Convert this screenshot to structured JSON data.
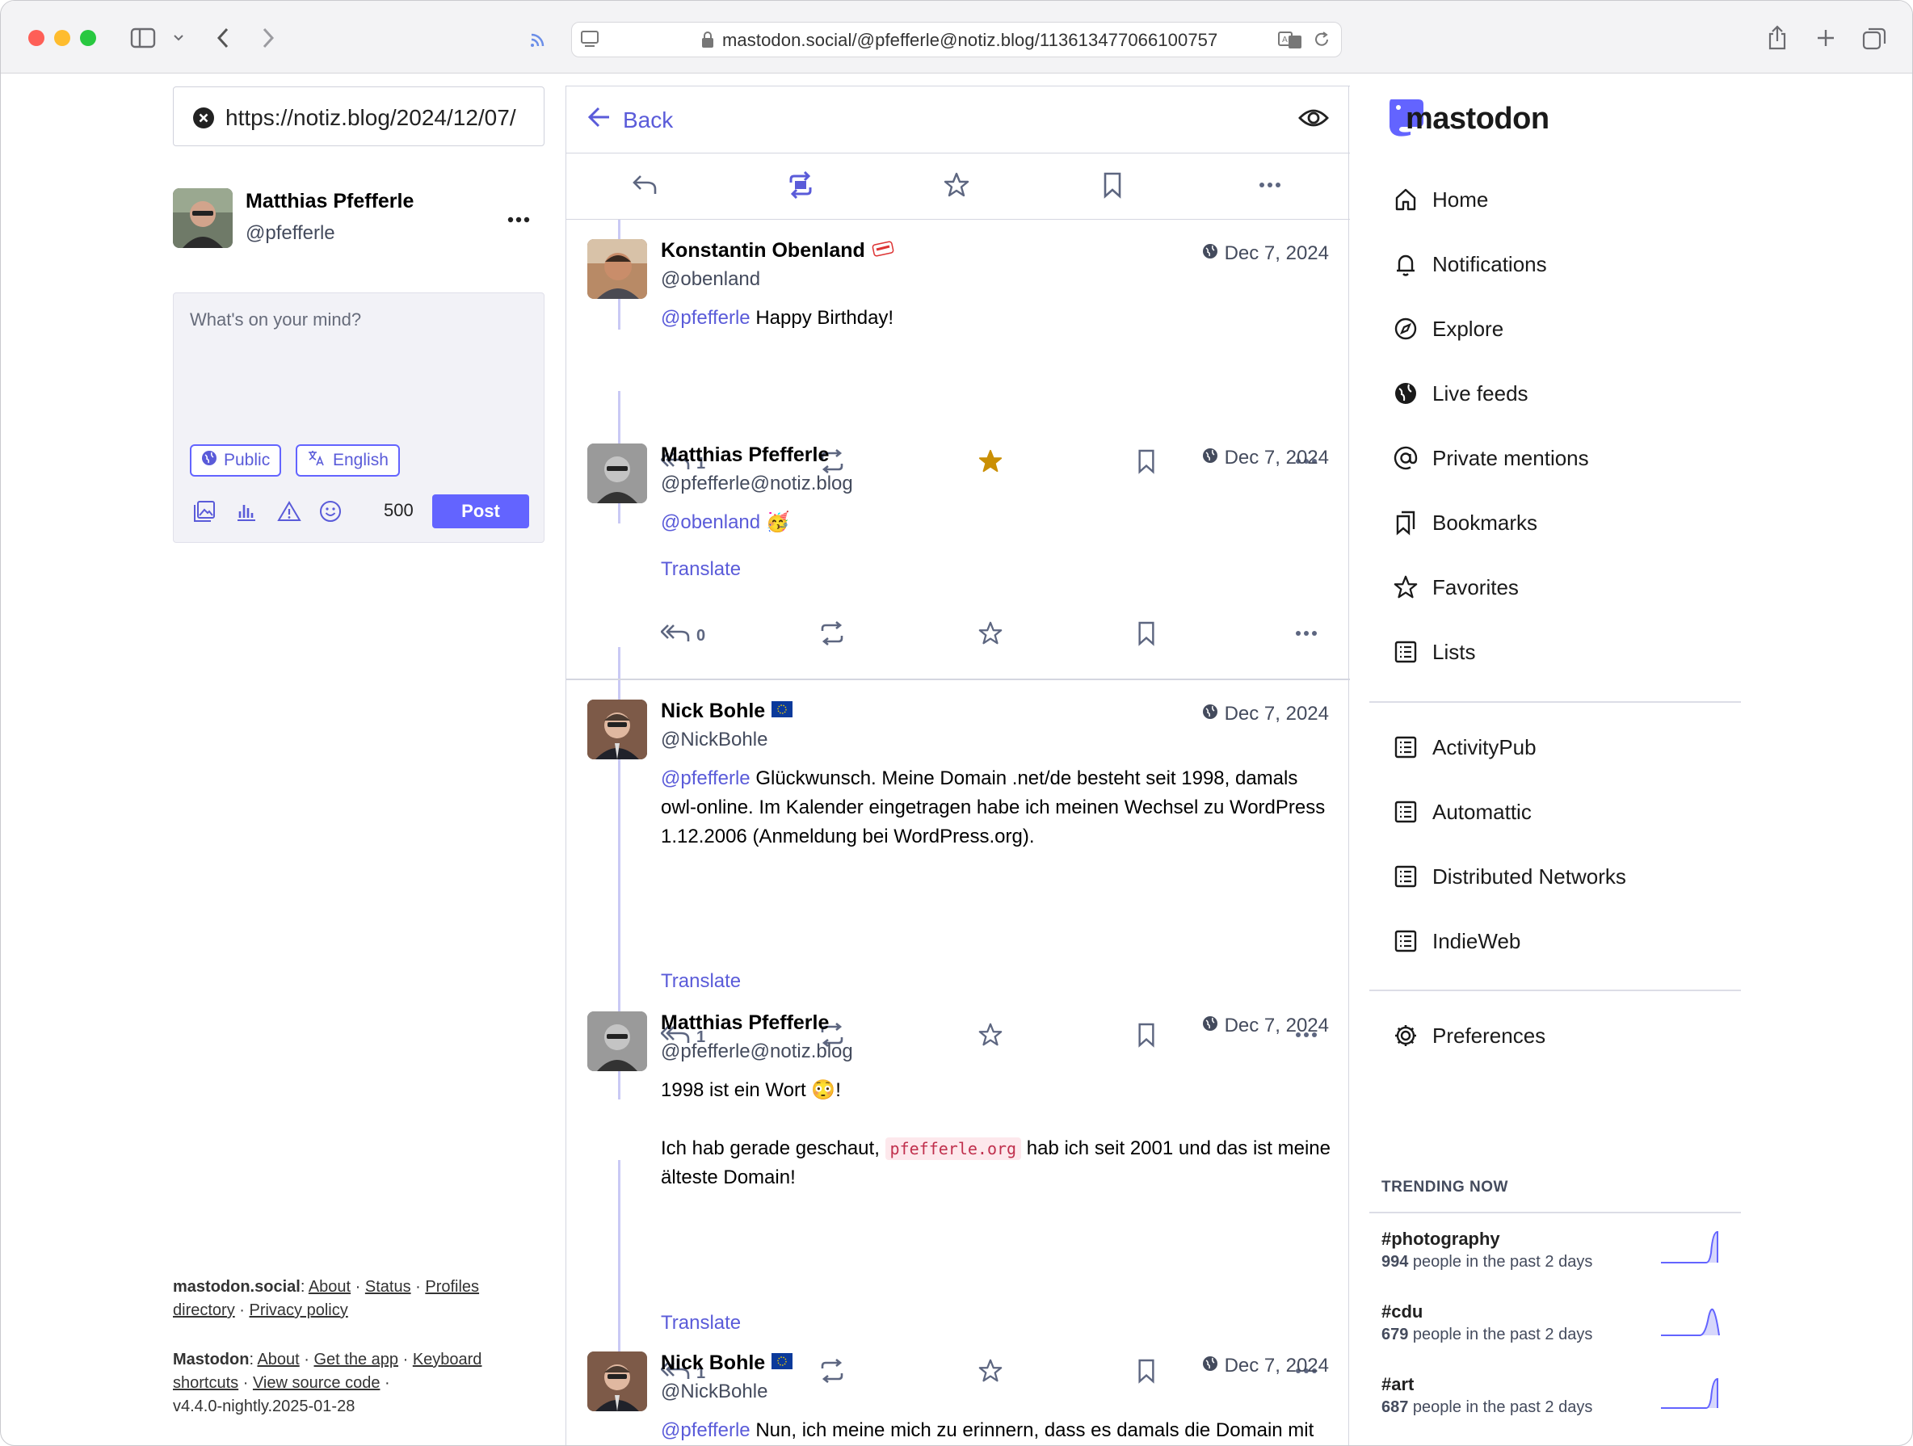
{
  "browser": {
    "url": "mastodon.social/@pfefferle@notiz.blog/113613477066100757"
  },
  "search": {
    "value": "https://notiz.blog/2024/12/07/"
  },
  "account": {
    "name": "Matthias Pfefferle",
    "handle": "@pfefferle"
  },
  "composer": {
    "placeholder": "What's on your mind?",
    "visibility": "Public",
    "language": "English",
    "char_count": "500",
    "post_label": "Post"
  },
  "footer": {
    "site": "mastodon.social",
    "site_links": [
      "About",
      "Status",
      "Profiles directory",
      "Privacy policy"
    ],
    "app": "Mastodon",
    "app_links": [
      "About",
      "Get the app",
      "Keyboard shortcuts",
      "View source code"
    ],
    "version": "v4.4.0-nightly.2025-01-28"
  },
  "column": {
    "back_label": "Back"
  },
  "statuses": [
    {
      "name": "Konstantin Obenland",
      "handle": "@obenland",
      "date": "Dec 7, 2024",
      "mention": "@pfefferle",
      "text": " Happy Birthday!",
      "replies": "1",
      "favourited": true
    },
    {
      "name": "Matthias Pfefferle",
      "handle": "@pfefferle@notiz.blog",
      "date": "Dec 7, 2024",
      "mention": "@obenland",
      "text": " 🥳",
      "translate": "Translate",
      "replies": "0"
    },
    {
      "name": "Nick Bohle",
      "handle": "@NickBohle",
      "date": "Dec 7, 2024",
      "mention": "@pfefferle",
      "text": " Glückwunsch. Meine Domain .net/de besteht seit 1998, damals owl-online. Im Kalender eingetragen habe ich meinen Wechsel zu WordPress 1.12.2006 (Anmeldung bei WordPress.org).",
      "translate": "Translate",
      "replies": "1"
    },
    {
      "name": "Matthias Pfefferle",
      "handle": "@pfefferle@notiz.blog",
      "date": "Dec 7, 2024",
      "line1": "1998 ist ein Wort 😳!",
      "line2_pre": "Ich hab gerade geschaut, ",
      "line2_code": "pfefferle.org",
      "line2_post": " hab ich seit 2001 und das ist meine älteste Domain!",
      "translate": "Translate",
      "replies": "1"
    },
    {
      "name": "Nick Bohle",
      "handle": "@NickBohle",
      "date": "Dec 7, 2024",
      "mention": "@pfefferle",
      "text": " Nun, ich meine mich zu erinnern, dass es damals die Domain mit"
    }
  ],
  "sidebar": {
    "logo": "mastodon",
    "nav": [
      {
        "label": "Home",
        "icon": "home-icon"
      },
      {
        "label": "Notifications",
        "icon": "bell-icon"
      },
      {
        "label": "Explore",
        "icon": "compass-icon"
      },
      {
        "label": "Live feeds",
        "icon": "globe-icon"
      },
      {
        "label": "Private mentions",
        "icon": "at-icon"
      },
      {
        "label": "Bookmarks",
        "icon": "bookmarks-icon"
      },
      {
        "label": "Favorites",
        "icon": "star-icon"
      },
      {
        "label": "Lists",
        "icon": "list-icon"
      }
    ],
    "lists": [
      {
        "label": "ActivityPub"
      },
      {
        "label": "Automattic"
      },
      {
        "label": "Distributed Networks"
      },
      {
        "label": "IndieWeb"
      }
    ],
    "preferences": "Preferences"
  },
  "trending": {
    "title": "TRENDING NOW",
    "items": [
      {
        "tag": "#photography",
        "count": "994",
        "suffix": " people in the past 2 days"
      },
      {
        "tag": "#cdu",
        "count": "679",
        "suffix": " people in the past 2 days"
      },
      {
        "tag": "#art",
        "count": "687",
        "suffix": " people in the past 2 days"
      }
    ]
  },
  "colors": {
    "accent": "#6364ff",
    "link": "#5a5bd9",
    "favourite": "#ca8f04",
    "muted": "#444b5d"
  }
}
